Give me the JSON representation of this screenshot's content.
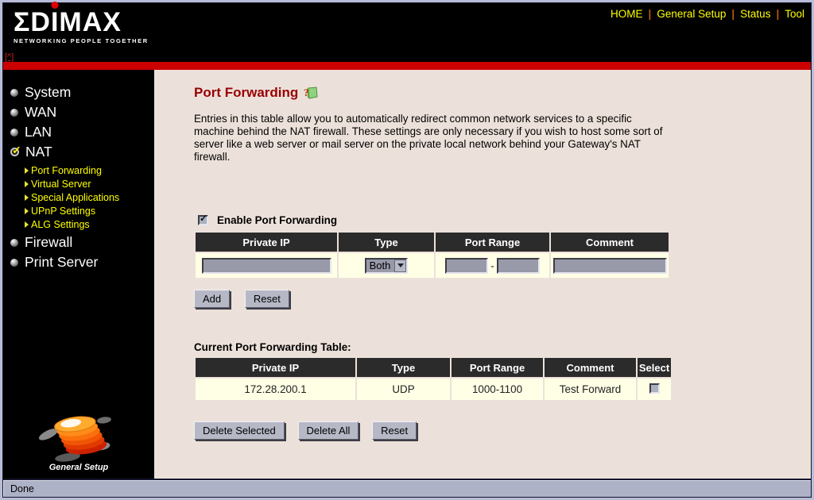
{
  "header": {
    "brand": "EDIMAX",
    "tagline": "NETWORKING PEOPLE TOGETHER",
    "top_link": "[^]",
    "nav": [
      {
        "label": "HOME"
      },
      {
        "label": "General Setup"
      },
      {
        "label": "Status"
      },
      {
        "label": "Tool"
      }
    ],
    "nav_separator": "|"
  },
  "sidebar": {
    "items": [
      {
        "label": "System"
      },
      {
        "label": "WAN"
      },
      {
        "label": "LAN"
      },
      {
        "label": "NAT",
        "selected": true
      },
      {
        "label": "Firewall"
      },
      {
        "label": "Print Server"
      }
    ],
    "nat_subitems": [
      {
        "label": "Port Forwarding"
      },
      {
        "label": "Virtual Server"
      },
      {
        "label": "Special Applications"
      },
      {
        "label": "UPnP Settings"
      },
      {
        "label": "ALG Settings"
      }
    ],
    "logo_caption": "General Setup"
  },
  "main": {
    "title": "Port Forwarding",
    "description": "Entries in this table allow you to automatically redirect common network services to a specific machine behind the NAT firewall. These settings are only necessary if you wish to host some sort of server like a web server or mail server on the private local network behind your Gateway's NAT firewall.",
    "enable": {
      "label": "Enable Port Forwarding",
      "checked": true
    },
    "form_table": {
      "headers": [
        "Private IP",
        "Type",
        "Port Range",
        "Comment"
      ],
      "private_ip_value": "",
      "type_selected": "Both",
      "port_start_value": "",
      "port_end_value": "",
      "range_separator": "-",
      "comment_value": ""
    },
    "form_buttons": {
      "add": "Add",
      "reset": "Reset"
    },
    "current_table": {
      "label": "Current Port Forwarding Table:",
      "headers": [
        "Private IP",
        "Type",
        "Port Range",
        "Comment",
        "Select"
      ],
      "rows": [
        {
          "private_ip": "172.28.200.1",
          "type": "UDP",
          "port_range": "1000-1100",
          "comment": "Test Forward",
          "selected": false
        }
      ]
    },
    "table_buttons": {
      "delete_selected": "Delete Selected",
      "delete_all": "Delete All",
      "reset": "Reset"
    }
  },
  "status_bar": {
    "text": "Done"
  },
  "colors": {
    "accent_red": "#cc0000",
    "title_red": "#990000",
    "nav_yellow": "#ffff00",
    "table_header_bg": "#2b2b2b",
    "row_cream": "#ffffe6",
    "content_bg": "#ece1da",
    "input_gray": "#9899a9"
  }
}
